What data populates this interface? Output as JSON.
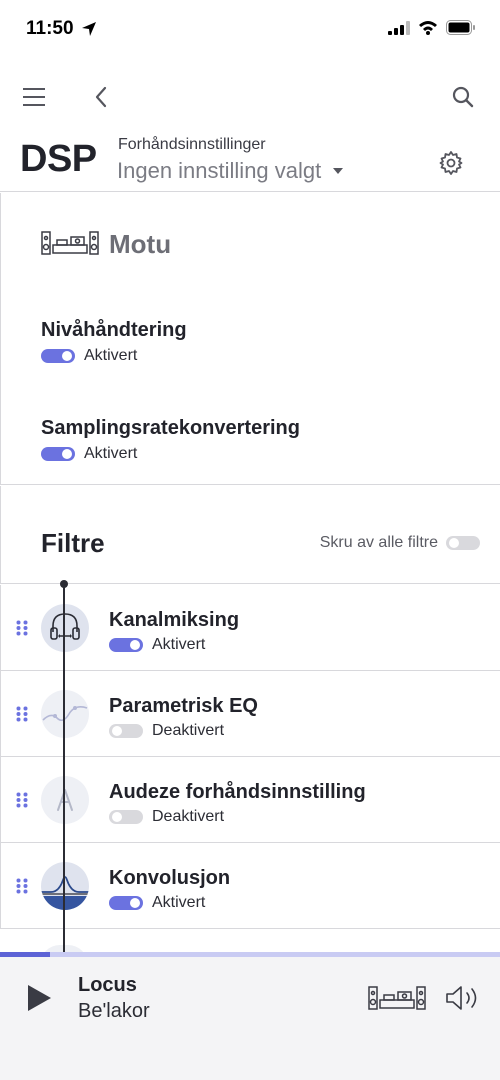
{
  "status_bar": {
    "time": "11:50"
  },
  "header": {
    "title": "DSP",
    "preset_label": "Forhåndsinnstillinger",
    "preset_value": "Ingen innstilling valgt"
  },
  "device": {
    "name": "Motu"
  },
  "settings": [
    {
      "title": "Nivåhåndtering",
      "state": "Aktivert",
      "enabled": true
    },
    {
      "title": "Samplingsratekonvertering",
      "state": "Aktivert",
      "enabled": true
    }
  ],
  "filters": {
    "title": "Filtre",
    "disable_all_label": "Skru av alle filtre",
    "items": [
      {
        "name": "Kanalmiksing",
        "state": "Aktivert",
        "enabled": true,
        "icon": "headphones-icon"
      },
      {
        "name": "Parametrisk EQ",
        "state": "Deaktivert",
        "enabled": false,
        "icon": "eq-curve-icon"
      },
      {
        "name": "Audeze forhåndsinnstilling",
        "state": "Deaktivert",
        "enabled": false,
        "icon": "audeze-icon"
      },
      {
        "name": "Konvolusjon",
        "state": "Aktivert",
        "enabled": true,
        "icon": "convolution-icon"
      }
    ]
  },
  "player": {
    "track": "Locus",
    "artist": "Be'lakor",
    "progress": 0.1
  },
  "colors": {
    "accent": "#6b72e0",
    "toggle_off": "#d9d9dd",
    "player_bg": "#f4f4f6"
  }
}
